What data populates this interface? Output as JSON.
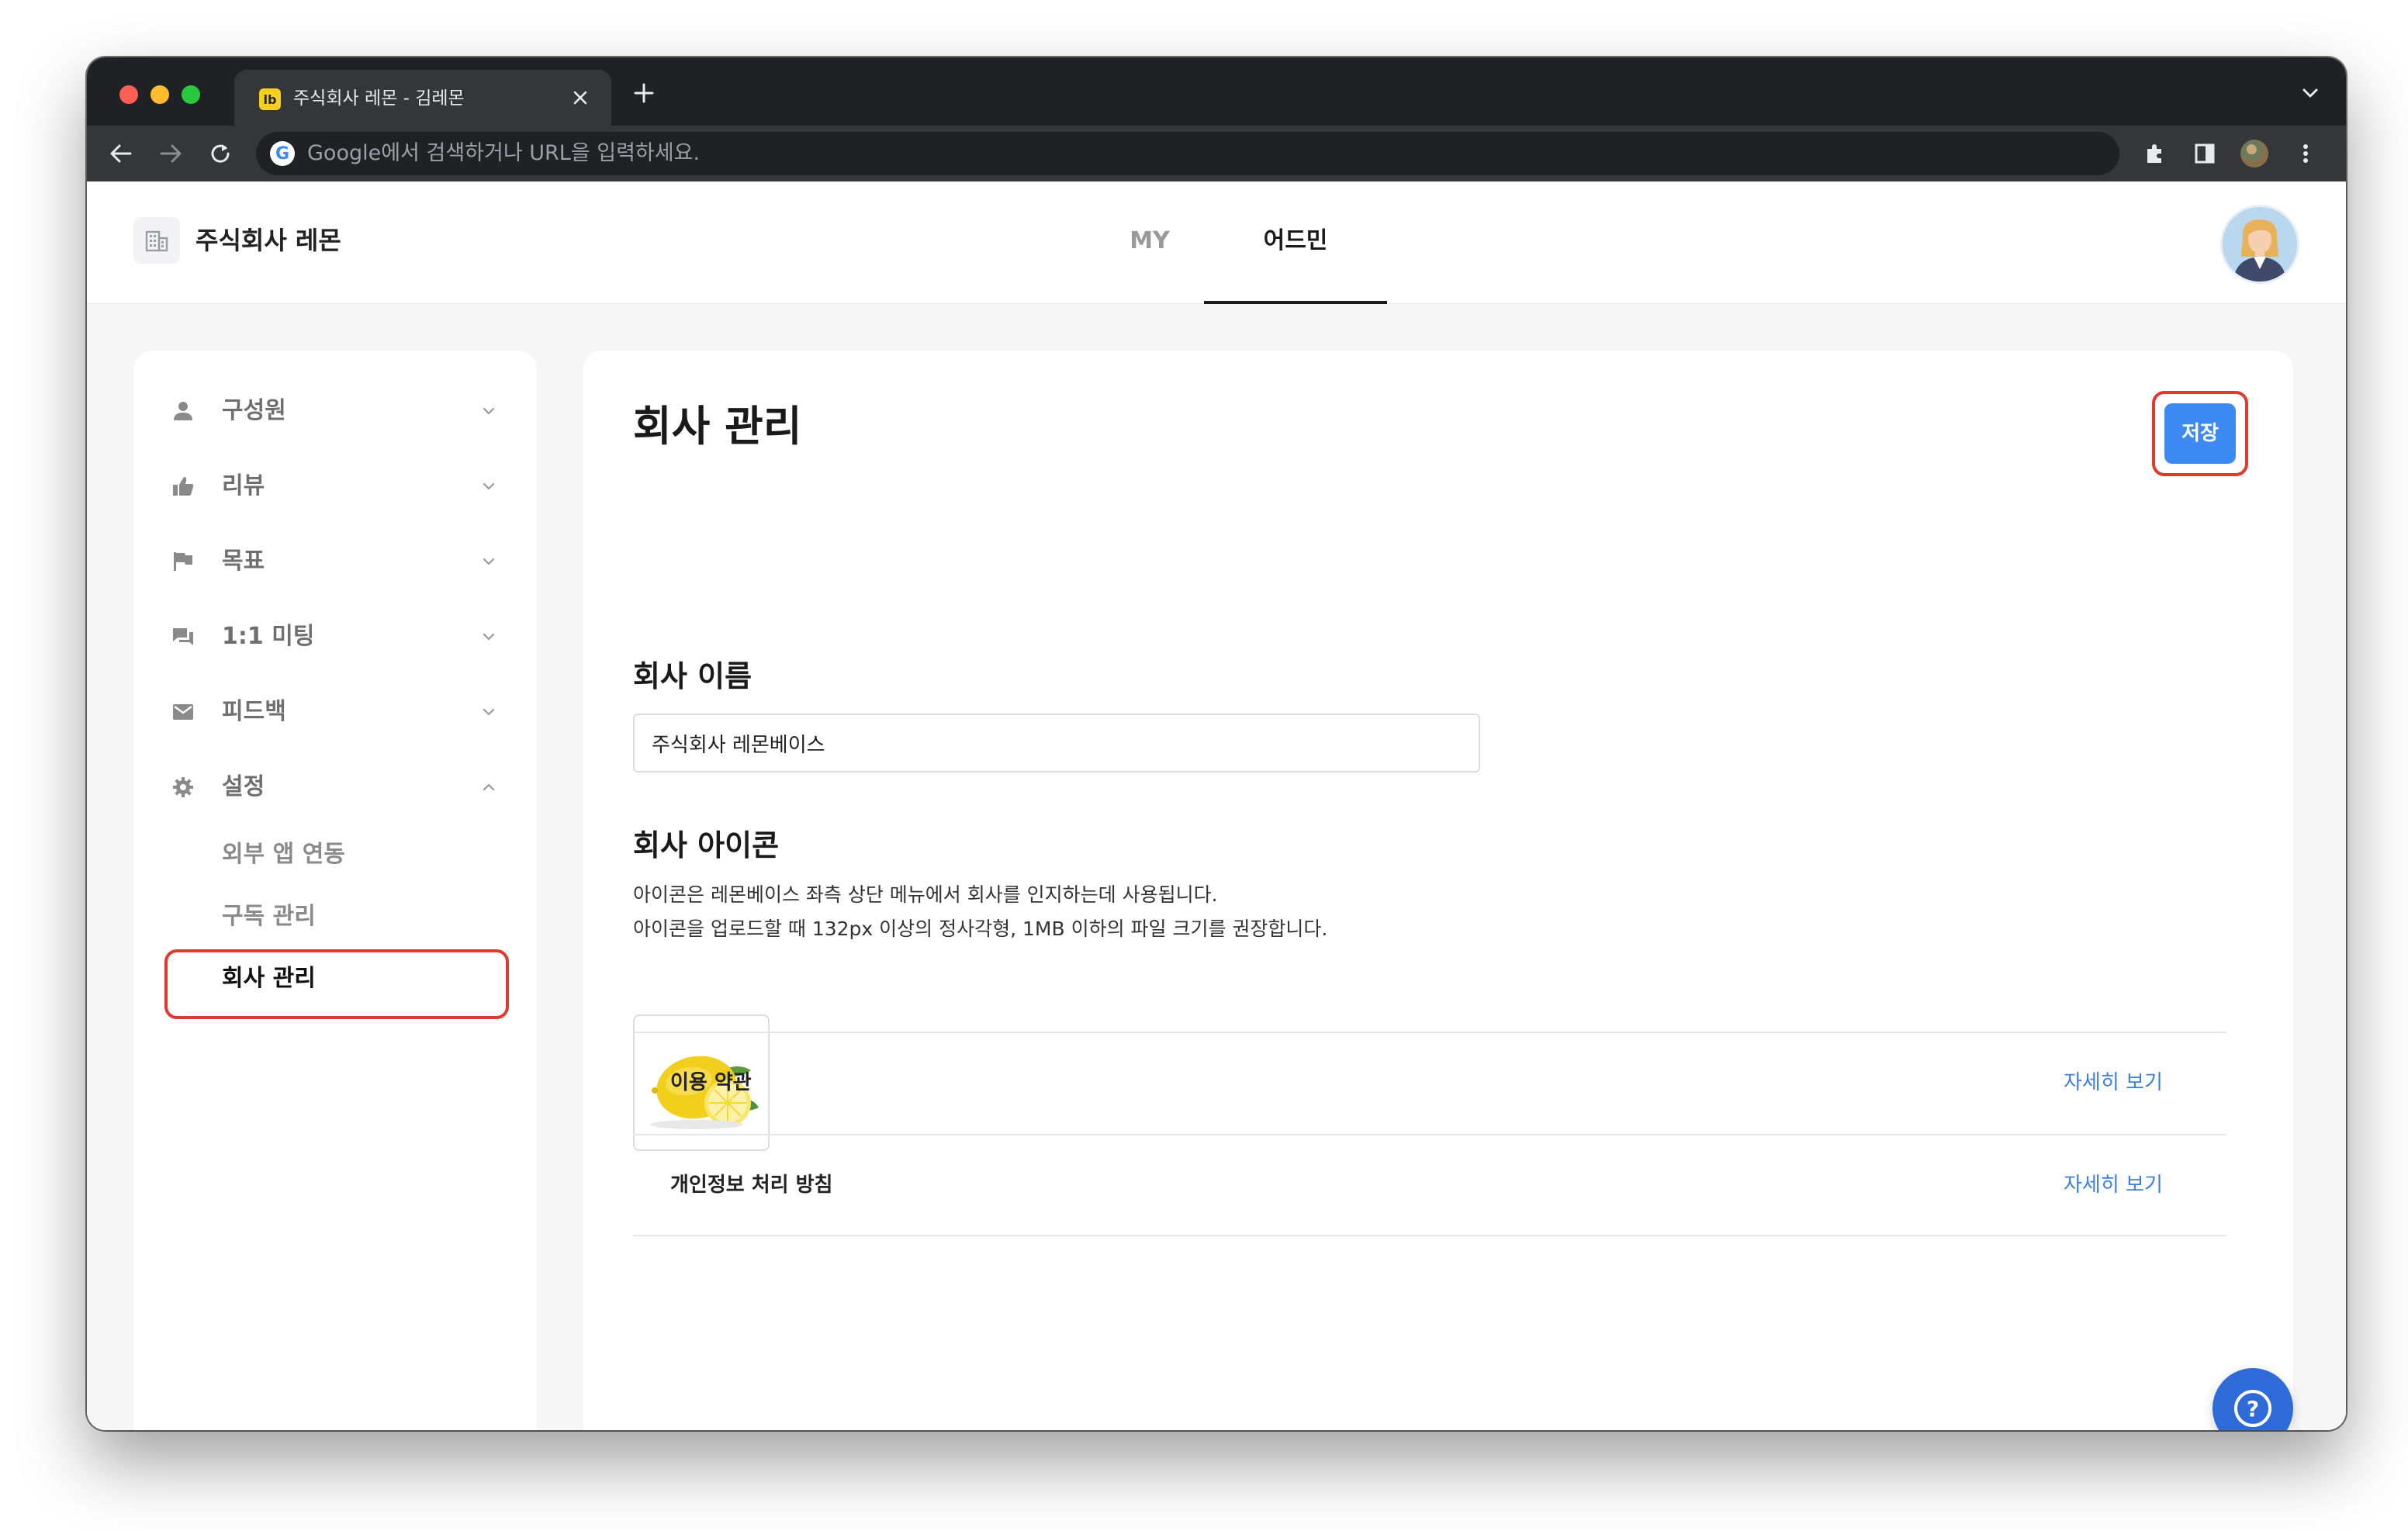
{
  "browser": {
    "tab_title": "주식회사 레몬 - 김레몬",
    "tab_favicon_text": "lb",
    "omnibox_placeholder": "Google에서 검색하거나 URL을 입력하세요.",
    "google_glyph": "G"
  },
  "header": {
    "company_name": "주식회사 레몬",
    "tabs": [
      {
        "label": "MY",
        "active": false
      },
      {
        "label": "어드민",
        "active": true
      }
    ]
  },
  "sidebar": {
    "items": [
      {
        "label": "구성원",
        "icon": "person-icon",
        "expanded": false
      },
      {
        "label": "리뷰",
        "icon": "thumbs-up-icon",
        "expanded": false
      },
      {
        "label": "목표",
        "icon": "flag-icon",
        "expanded": false
      },
      {
        "label": "1:1 미팅",
        "icon": "chat-icon",
        "expanded": false
      },
      {
        "label": "피드백",
        "icon": "mail-icon",
        "expanded": false
      },
      {
        "label": "설정",
        "icon": "gear-icon",
        "expanded": true
      }
    ],
    "sub_items": [
      {
        "label": "외부 앱 연동",
        "active": false
      },
      {
        "label": "구독 관리",
        "active": false
      },
      {
        "label": "회사 관리",
        "active": true
      }
    ]
  },
  "main": {
    "title": "회사 관리",
    "save_label": "저장",
    "company_name_heading": "회사 이름",
    "company_name_value": "주식회사 레몬베이스",
    "icon_heading": "회사 아이콘",
    "icon_desc_1": "아이콘은 레몬베이스 좌측 상단 메뉴에서 회사를 인지하는데 사용됩니다.",
    "icon_desc_2": "아이콘을 업로드할 때 132px 이상의 정사각형, 1MB 이하의 파일 크기를 권장합니다.",
    "policy_rows": [
      {
        "label": "이용 약관",
        "link": "자세히 보기"
      },
      {
        "label": "개인정보 처리 방침",
        "link": "자세히 보기"
      }
    ]
  },
  "help_glyph": "?",
  "colors": {
    "accent": "#3d8bf2",
    "highlight": "#e0392e",
    "link": "#3d7fe0",
    "help_fab": "#2f6bd8"
  }
}
